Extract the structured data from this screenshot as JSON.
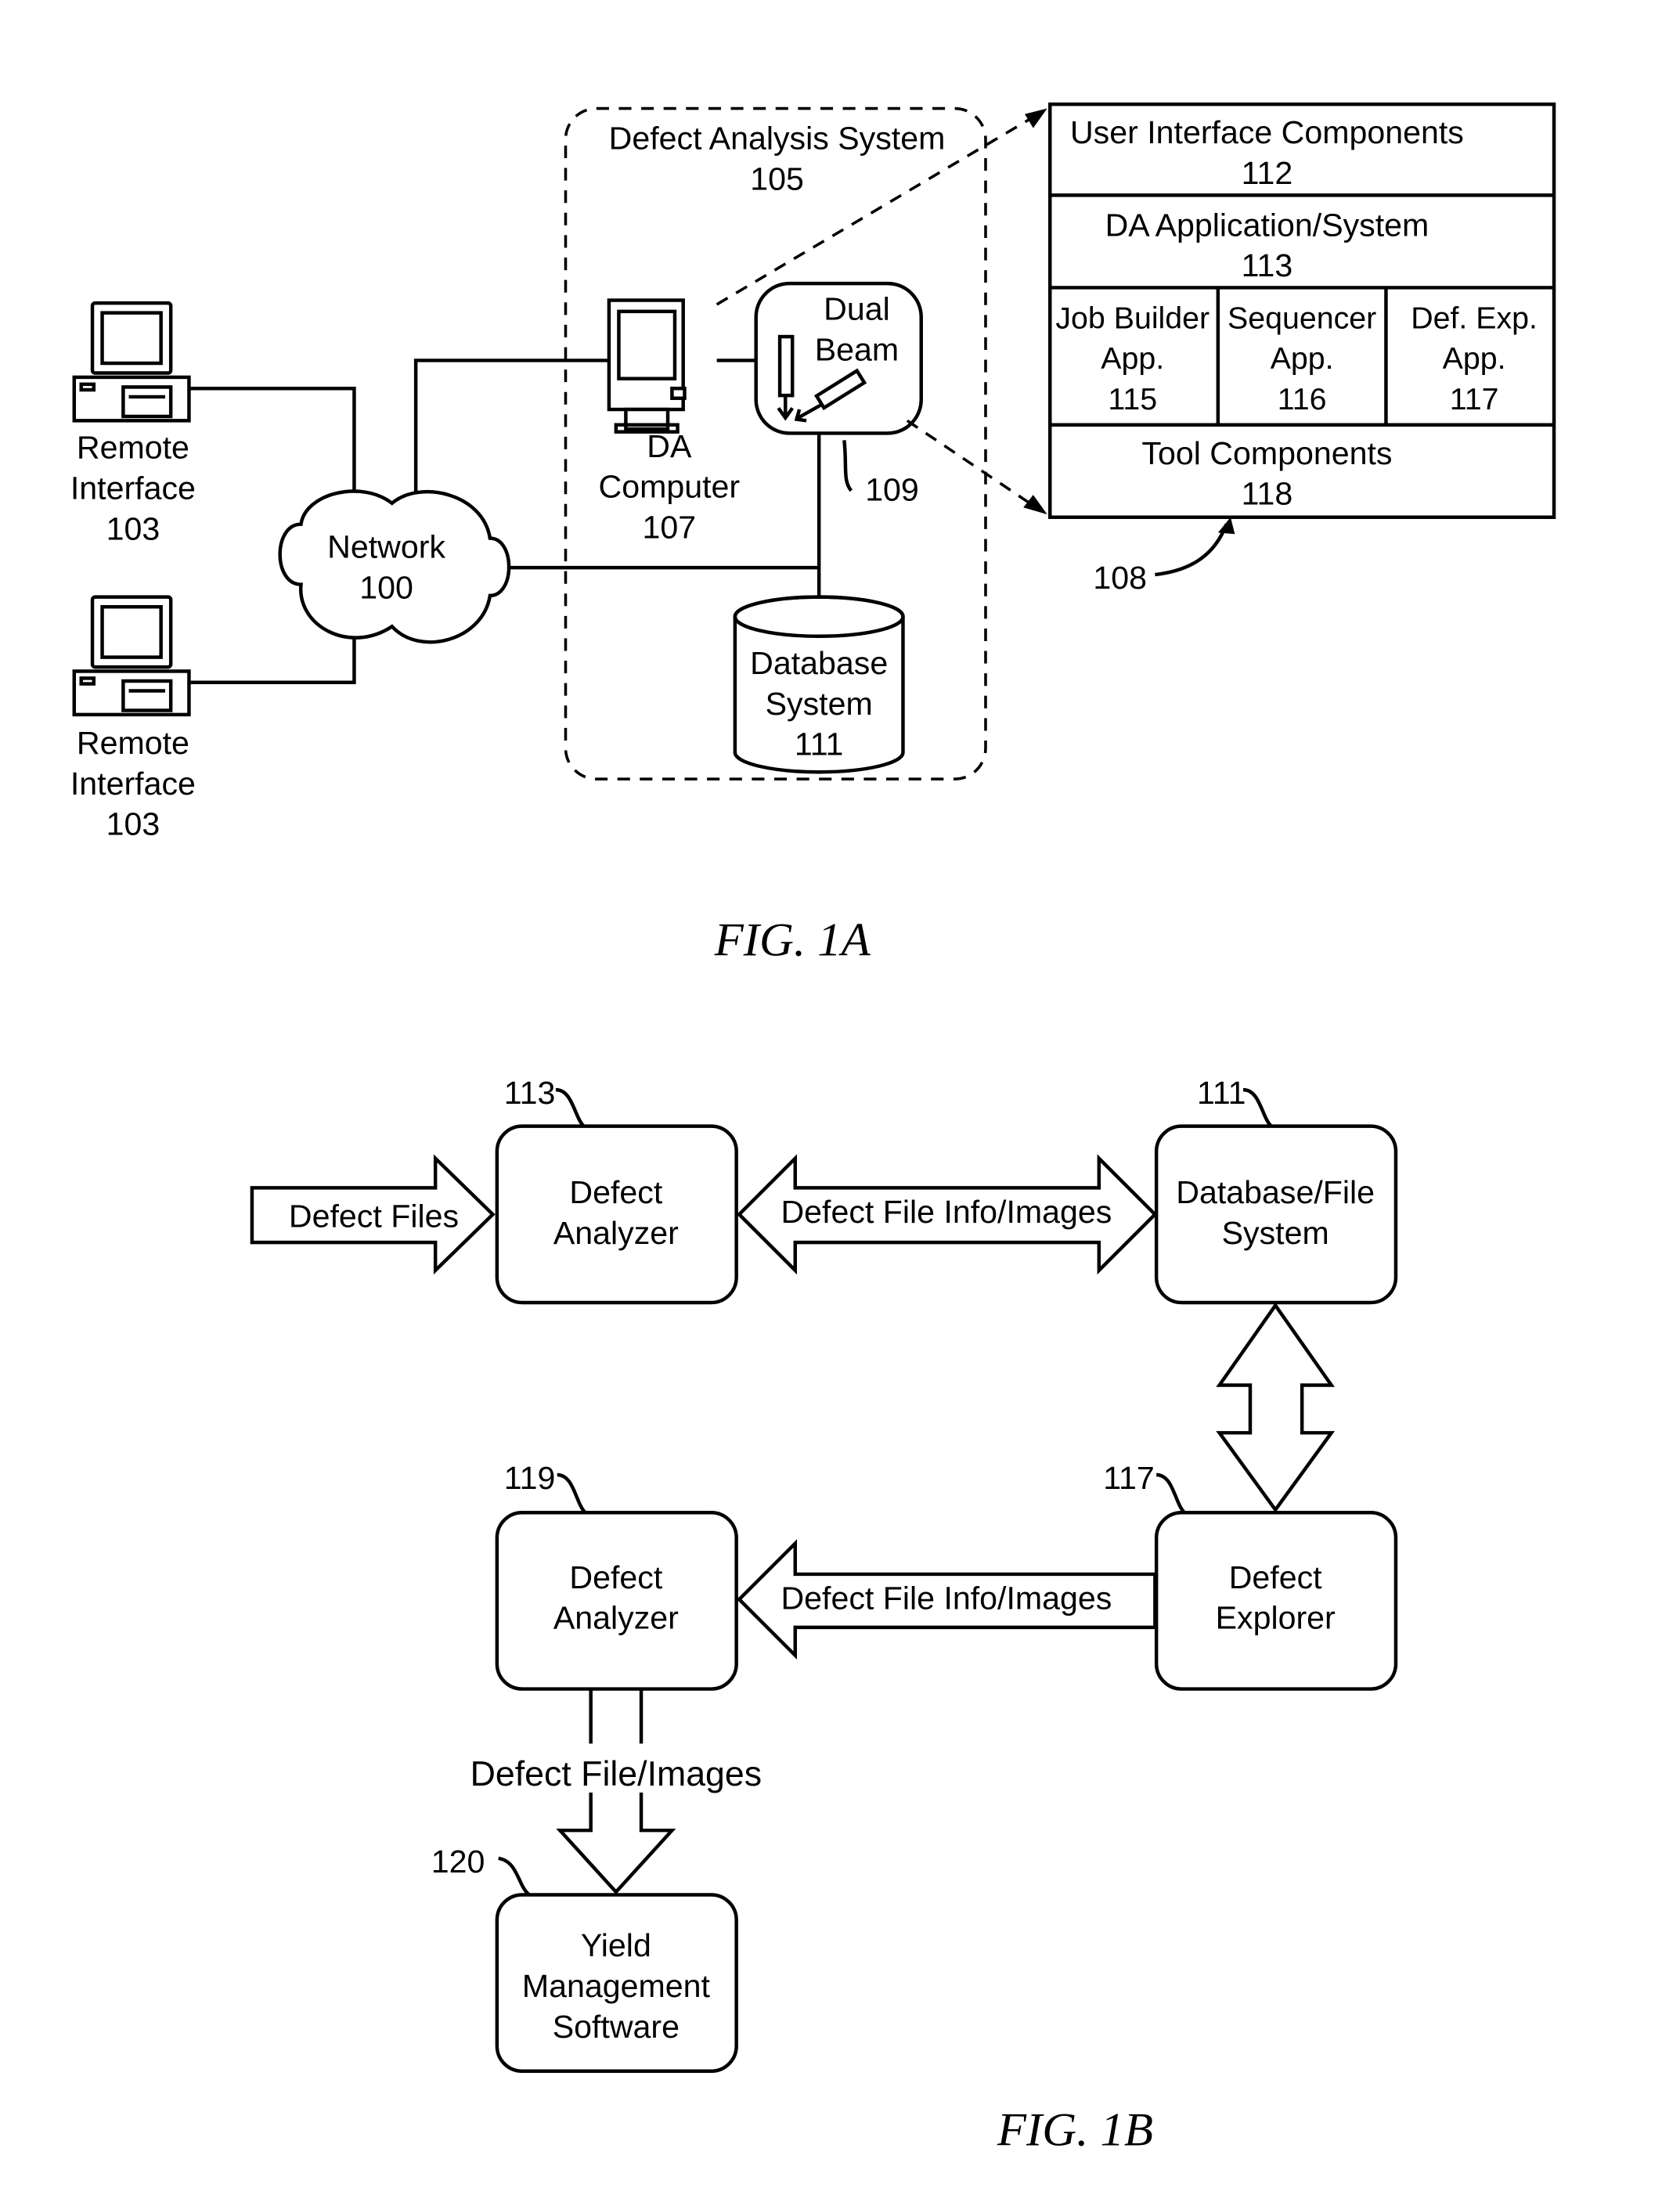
{
  "fig1a": {
    "caption": "FIG. 1A",
    "remote_interfaces": [
      {
        "line1": "Remote",
        "line2": "Interface",
        "ref": "103"
      },
      {
        "line1": "Remote",
        "line2": "Interface",
        "ref": "103"
      }
    ],
    "network": {
      "label": "Network",
      "ref": "100"
    },
    "system": {
      "label": "Defect Analysis System",
      "ref": "105"
    },
    "da_computer": {
      "line1": "DA",
      "line2": "Computer",
      "ref": "107"
    },
    "dual_beam": {
      "line1": "Dual",
      "line2": "Beam",
      "ref": "109"
    },
    "database": {
      "line1": "Database",
      "line2": "System",
      "ref": "111"
    },
    "stack": {
      "ref": "108",
      "ui_components": {
        "label": "User Interface Components",
        "ref": "112"
      },
      "da_application": {
        "label": "DA Application/System",
        "ref": "113"
      },
      "apps": [
        {
          "line1": "Job Builder",
          "line2": "App.",
          "ref": "115"
        },
        {
          "line1": "Sequencer",
          "line2": "App.",
          "ref": "116"
        },
        {
          "line1": "Def. Exp.",
          "line2": "App.",
          "ref": "117"
        }
      ],
      "tool_components": {
        "label": "Tool Components",
        "ref": "118"
      }
    }
  },
  "fig1b": {
    "caption": "FIG. 1B",
    "nodes": {
      "analyzer_113": {
        "line1": "Defect",
        "line2": "Analyzer",
        "ref": "113"
      },
      "db_111": {
        "line1": "Database/File",
        "line2": "System",
        "ref": "111"
      },
      "analyzer_119": {
        "line1": "Defect",
        "line2": "Analyzer",
        "ref": "119"
      },
      "explorer_117": {
        "line1": "Defect",
        "line2": "Explorer",
        "ref": "117"
      },
      "yield_120": {
        "line1": "Yield",
        "line2": "Management",
        "line3": "Software",
        "ref": "120"
      }
    },
    "arrows": {
      "defect_files": "Defect Files",
      "info_images_top": "Defect File Info/Images",
      "info_images_bottom": "Defect File Info/Images",
      "file_images": "Defect File/Images"
    }
  }
}
